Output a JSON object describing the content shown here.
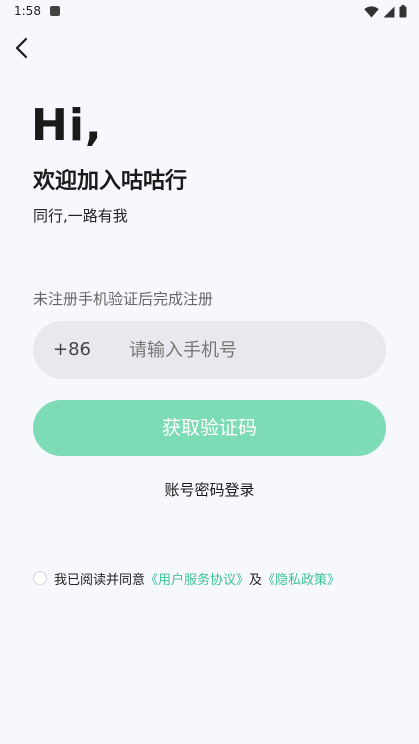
{
  "status_bar": {
    "time": "1:58"
  },
  "header": {
    "greeting": "Hi,",
    "welcome": "欢迎加入咕咕行",
    "slogan": "同行,一路有我"
  },
  "form": {
    "hint": "未注册手机验证后完成注册",
    "country_code": "+86",
    "phone_placeholder": "请输入手机号",
    "phone_value": "",
    "get_code_label": "获取验证码",
    "password_login_label": "账号密码登录"
  },
  "agreement": {
    "prefix": "我已阅读并同意",
    "user_agreement": "《用户服务协议》",
    "and": "及",
    "privacy_policy": "《隐私政策》",
    "checked": false
  },
  "colors": {
    "accent": "#7ddcb6",
    "link": "#3bc394",
    "background": "#f7f8fd",
    "input_bg": "#e8e9ee"
  }
}
